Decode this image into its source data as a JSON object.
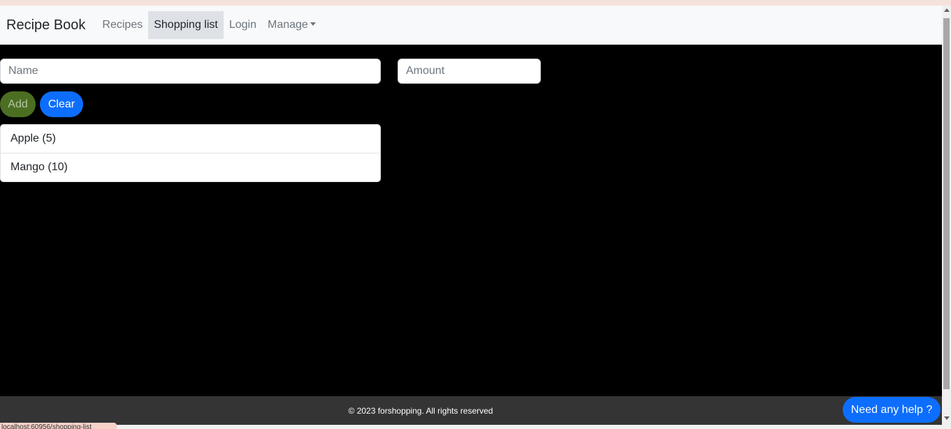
{
  "navbar": {
    "brand": "Recipe Book",
    "items": [
      {
        "label": "Recipes"
      },
      {
        "label": "Shopping list",
        "active": true
      },
      {
        "label": "Login"
      },
      {
        "label": "Manage"
      }
    ]
  },
  "form": {
    "name_placeholder": "Name",
    "amount_placeholder": "Amount",
    "add_label": "Add",
    "clear_label": "Clear"
  },
  "ingredients": [
    {
      "label": "Apple (5)"
    },
    {
      "label": "Mango (10)"
    }
  ],
  "footer": {
    "text": "© 2023 forshopping. All rights reserved"
  },
  "help": {
    "label": "Need any help ?"
  },
  "statusbar": {
    "url": "localhost:60956/shopping-list"
  },
  "colors": {
    "navbar_bg": "#f8f9fa",
    "page_bg": "#000000",
    "primary": "#0d6efd",
    "add_button": "#4b6e22",
    "footer_bg": "#343434"
  }
}
